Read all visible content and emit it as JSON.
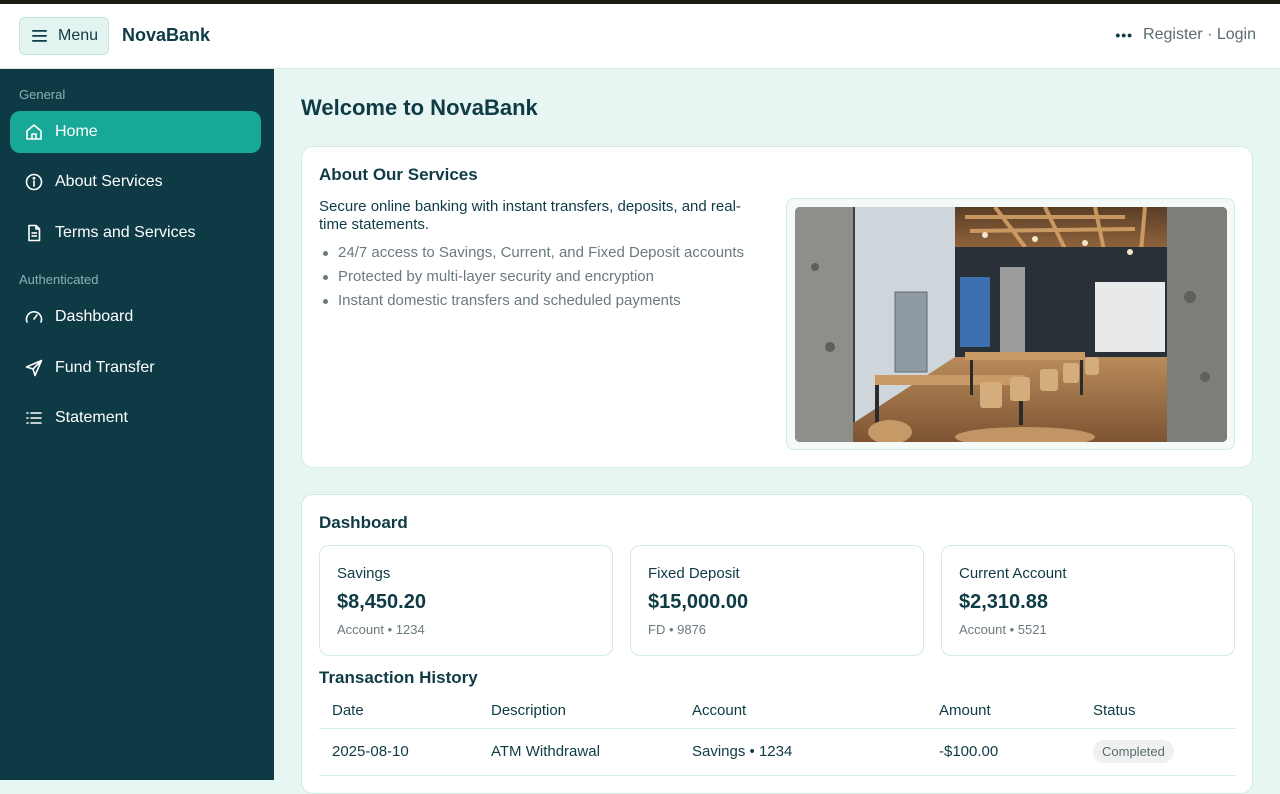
{
  "header": {
    "menu_label": "Menu",
    "brand": "NovaBank",
    "register_label": "Register",
    "separator": "·",
    "login_label": "Login"
  },
  "sidebar": {
    "sections": [
      {
        "title": "General",
        "items": [
          {
            "label": "Home",
            "icon": "home-icon",
            "active": true
          },
          {
            "label": "About Services",
            "icon": "info-icon",
            "active": false
          },
          {
            "label": "Terms and Services",
            "icon": "document-icon",
            "active": false
          }
        ]
      },
      {
        "title": "Authenticated",
        "items": [
          {
            "label": "Dashboard",
            "icon": "gauge-icon",
            "active": false
          },
          {
            "label": "Fund Transfer",
            "icon": "send-icon",
            "active": false
          },
          {
            "label": "Statement",
            "icon": "list-icon",
            "active": false
          }
        ]
      }
    ]
  },
  "main": {
    "title": "Welcome to NovaBank",
    "about": {
      "title": "About Our Services",
      "description": "Secure online banking with instant transfers, deposits, and real-time statements.",
      "features": [
        "24/7 access to Savings, Current, and Fixed Deposit accounts",
        "Protected by multi-layer security and encryption",
        "Instant domestic transfers and scheduled payments"
      ]
    },
    "dashboard": {
      "title": "Dashboard",
      "accounts": [
        {
          "label": "Savings",
          "amount": "$8,450.20",
          "sub": "Account • 1234"
        },
        {
          "label": "Fixed Deposit",
          "amount": "$15,000.00",
          "sub": "FD • 9876"
        },
        {
          "label": "Current Account",
          "amount": "$2,310.88",
          "sub": "Account • 5521"
        }
      ],
      "history": {
        "title": "Transaction History",
        "columns": [
          "Date",
          "Description",
          "Account",
          "Amount",
          "Status"
        ],
        "rows": [
          {
            "date": "2025-08-10",
            "description": "ATM Withdrawal",
            "account": "Savings • 1234",
            "amount": "-$100.00",
            "status": "Completed"
          }
        ]
      }
    }
  },
  "colors": {
    "sidebar_bg": "#0d3a44",
    "accent": "#17a897",
    "main_bg": "#e8f6f3",
    "text": "#0e3b45"
  }
}
